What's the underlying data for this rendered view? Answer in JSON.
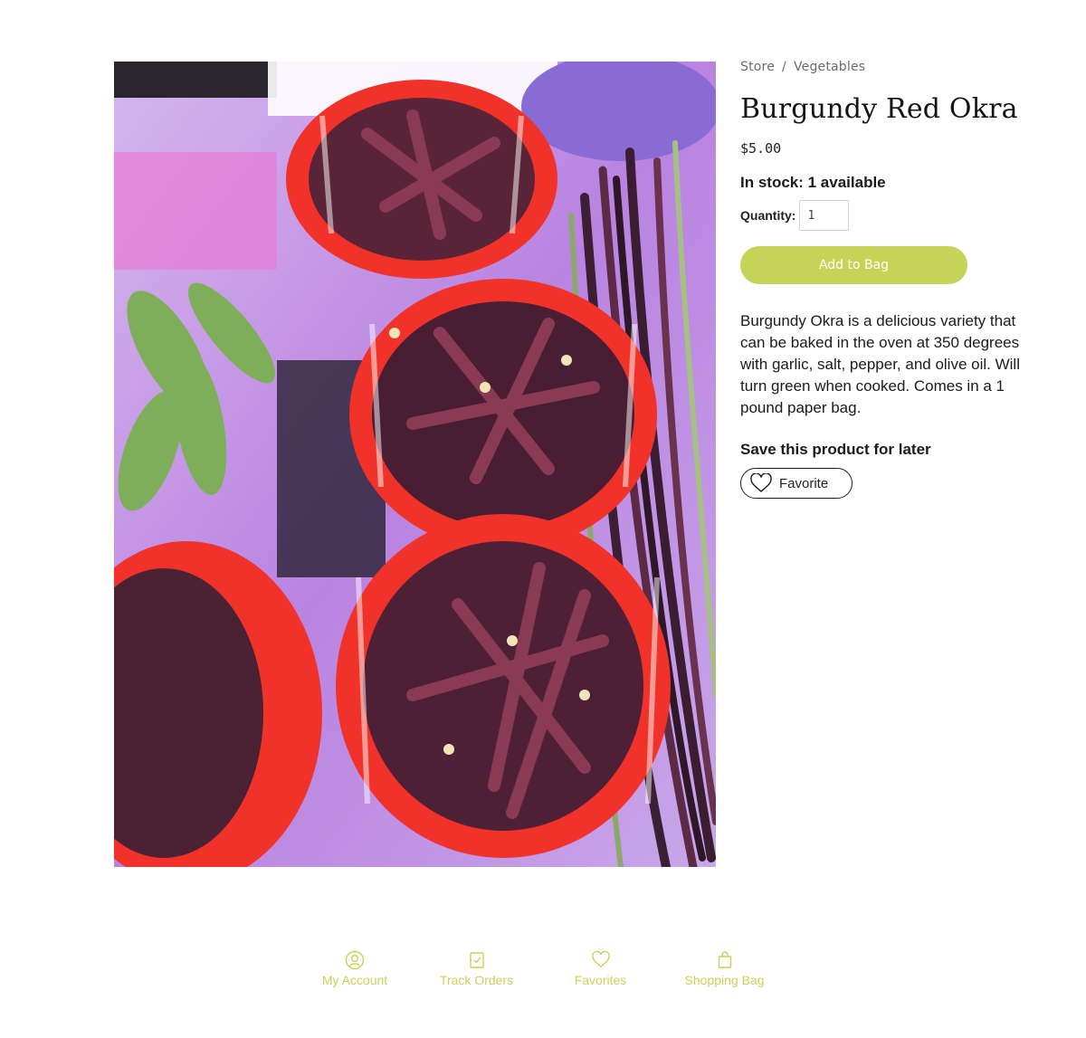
{
  "breadcrumb": {
    "items": [
      "Store",
      "Vegetables"
    ],
    "separator": "/"
  },
  "product": {
    "title": "Burgundy Red Okra",
    "price": "$5.00",
    "stock": "In stock: 1 available",
    "quantity_label": "Quantity:",
    "quantity_value": "1",
    "add_to_bag_label": "Add to Bag",
    "description": "Burgundy Okra is a delicious variety that can be baked in the oven at 350 degrees with garlic, salt, pepper, and olive oil. Will turn green when cooked. Comes in a 1 pound paper bag.",
    "save_heading": "Save this product for later",
    "favorite_label": "Favorite",
    "image_icon": "product-photo"
  },
  "footer_nav": {
    "items": [
      {
        "label": "My Account",
        "icon": "account-icon"
      },
      {
        "label": "Track Orders",
        "icon": "track-orders-icon"
      },
      {
        "label": "Favorites",
        "icon": "heart-icon"
      },
      {
        "label": "Shopping Bag",
        "icon": "shopping-bag-icon"
      }
    ]
  },
  "colors": {
    "accent": "#c5d456",
    "basket": "#f0322a",
    "okra": "#6b2a3f"
  }
}
